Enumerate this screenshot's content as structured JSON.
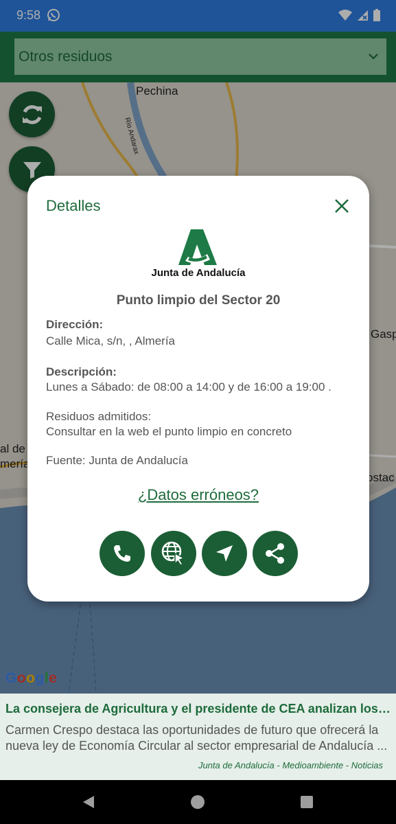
{
  "status_bar": {
    "time": "9:58"
  },
  "filter": {
    "selected": "Otros residuos"
  },
  "map": {
    "labels": {
      "pechina": "Pechina",
      "river": "Río Andarax",
      "gasp": "Gasp",
      "almeria_1": "al de",
      "almeria_2": "mería",
      "costa": "ostac"
    },
    "google": [
      "G",
      "o",
      "o",
      "g",
      "l",
      "e"
    ]
  },
  "dialog": {
    "title": "Detalles",
    "logo_text": "Junta de Andalucía",
    "point_name": "Punto limpio del Sector 20",
    "address_label": "Dirección:",
    "address_value": "Calle Mica, s/n, , Almería",
    "description_label": "Descripción:",
    "description_value": "Lunes a Sábado: de 08:00 a 14:00 y de 16:00 a 19:00 .",
    "waste_label": "Residuos admitidos:",
    "waste_value": "Consultar en la web el punto limpio en concreto",
    "source": "Fuente: Junta de Andalucía",
    "report_link": "¿Datos erróneos?"
  },
  "news": {
    "title": "La consejera de Agricultura y el presidente de CEA analizan los retos",
    "body": "Carmen Crespo destaca las oportunidades de futuro que ofrecerá la nueva ley de Economía Circular al sector empresarial de Andalucía  ...",
    "source": "Junta de Andalucía - Medioambiente - Noticias"
  },
  "colors": {
    "primary": "#1e7a46",
    "primary_dark": "#1b5e35",
    "status_bar": "#2f7de1",
    "sea": "#6a8fb6"
  }
}
